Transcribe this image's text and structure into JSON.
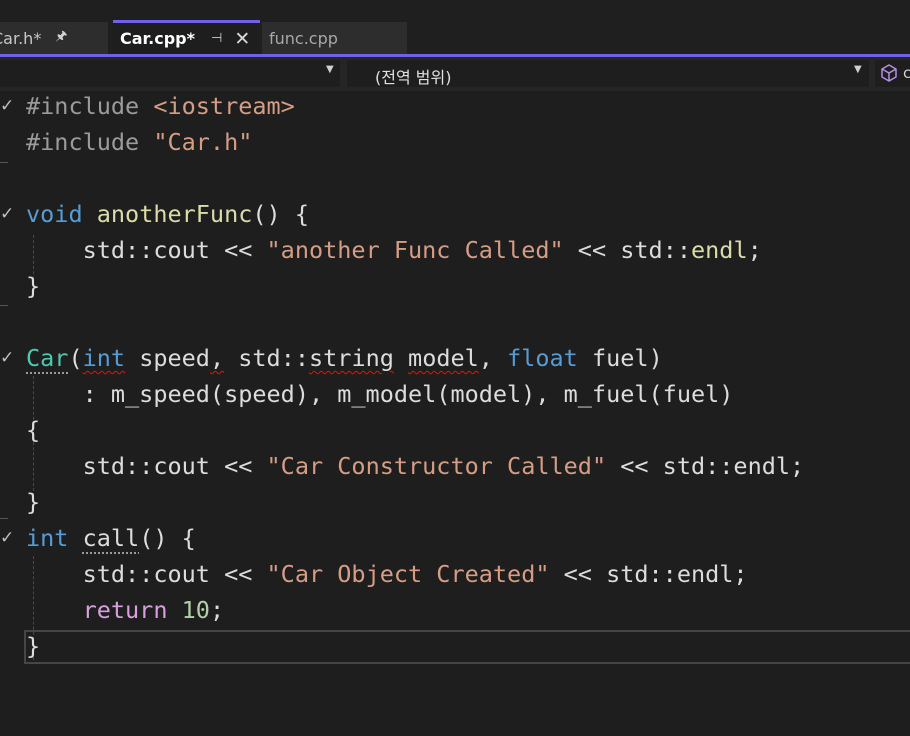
{
  "tabs": [
    {
      "label": "Car.h*",
      "visible_label": "Car.h*",
      "pin": "🖈"
    },
    {
      "label": "Car.cpp*",
      "pin": "⊣",
      "close": "✕"
    },
    {
      "label": "func.cpp"
    }
  ],
  "navbar": {
    "scope": "(전역 범위)",
    "member_fragment": "c",
    "member_icon": "cube-icon"
  },
  "colors": {
    "accent": "#7160e8",
    "keyword": "#569cd6",
    "string": "#d69d85",
    "function": "#dcdcaa",
    "type": "#4ec9b0",
    "control": "#d8a0df",
    "number": "#b5cea8"
  },
  "code": {
    "l1": {
      "a": "#include ",
      "b": "<iostream>"
    },
    "l2": {
      "a": "#include ",
      "b": "\"Car.h\""
    },
    "l4": {
      "a": "void",
      "b": " ",
      "c": "anotherFunc",
      "d": "() {"
    },
    "l5": {
      "a": "    std::cout << ",
      "b": "\"another Func Called\"",
      "c": " << std::",
      "d": "endl",
      "e": ";"
    },
    "l6": {
      "a": "}"
    },
    "l8": {
      "a": "Car",
      "b": "(",
      "c": "int",
      "d": " speed",
      "e": ",",
      "f": " std::",
      "g": "string",
      "h": " ",
      "i": "model",
      "j": ", ",
      "k": "float",
      "l": " fuel)"
    },
    "l9": {
      "a": "    : m_speed(speed), m_model(model), m_fuel(fuel)"
    },
    "l10": {
      "a": "{"
    },
    "l11": {
      "a": "    std::cout << ",
      "b": "\"Car Constructor Called\"",
      "c": " << std::endl;"
    },
    "l12": {
      "a": "}"
    },
    "l13": {
      "a": "int",
      "b": " ",
      "c": "call",
      "d": "() {"
    },
    "l14": {
      "a": "    std::cout << ",
      "b": "\"Car Object Created\"",
      "c": " << std::endl;"
    },
    "l15": {
      "a": "    ",
      "b": "return",
      "c": " ",
      "d": "10",
      "e": ";"
    },
    "l16": {
      "a": "}"
    }
  }
}
